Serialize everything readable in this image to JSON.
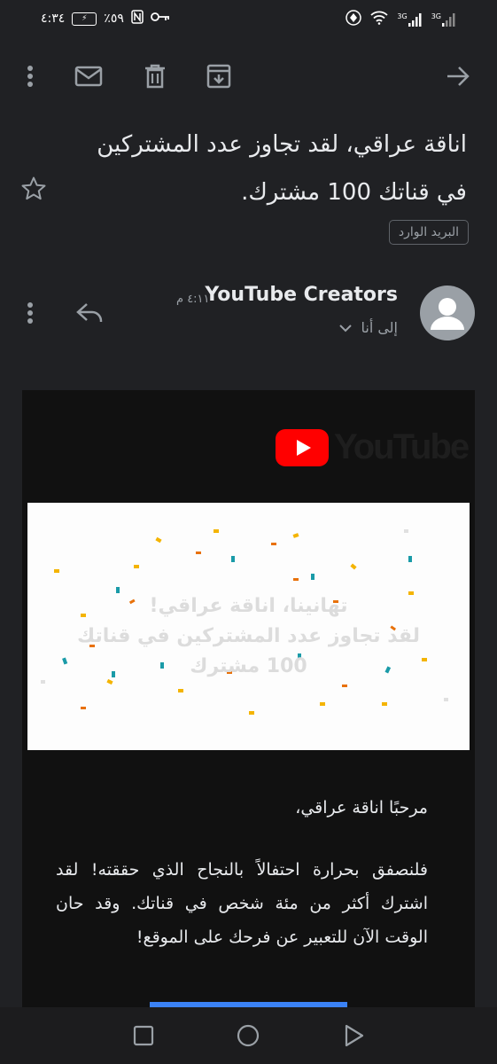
{
  "status_bar": {
    "time": "٤:٣٤",
    "battery_percent": "٪٥٩",
    "network_1": "3G",
    "network_2": "3G"
  },
  "toolbar": {
    "icons": [
      "more-vert-icon",
      "mail-icon",
      "delete-icon",
      "archive-icon",
      "forward-arrow-icon"
    ]
  },
  "email": {
    "subject": "اناقة عراقي، لقد تجاوز عدد المشتركين في قناتك 100 مشترك.",
    "label": "البريد الوارد",
    "sender_name": "YouTube Creators",
    "time": "٤:١١ م",
    "recipient": "إلى أنا"
  },
  "body": {
    "logo_text": "YouTube",
    "banner_lines": [
      "تهانينا، اناقة عراقي!",
      "لقد تجاوز عدد المشتركين في قناتك",
      "100 مشترك"
    ],
    "greeting": "مرحبًا اناقة عراقي،",
    "paragraph": "فلنصفق بحرارة احتفالاً بالنجاح الذي حققته! لقد اشترك أكثر من مئة شخص في قناتك. وقد حان الوقت الآن للتعبير عن فرحك على الموقع!"
  },
  "colors": {
    "background": "#202124",
    "email_body": "#111111",
    "youtube_red": "#ff0000",
    "button_blue": "#3b82f6"
  }
}
